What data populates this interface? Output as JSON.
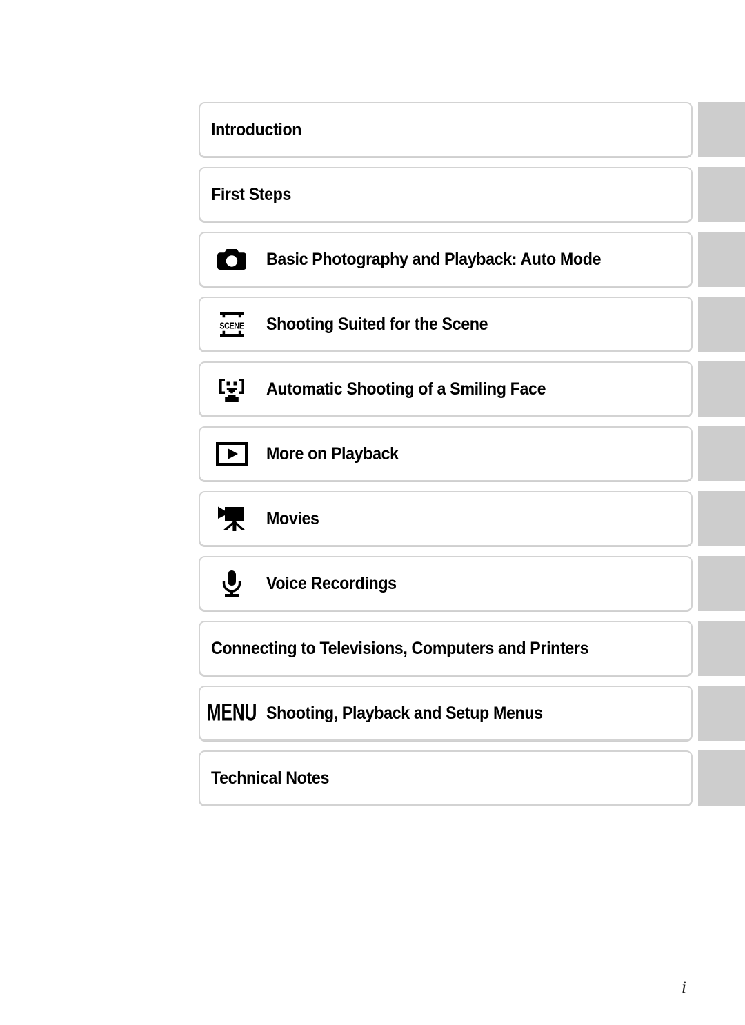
{
  "page": {
    "folio": "i"
  },
  "chapters": [
    {
      "label": "Introduction",
      "icon": "none"
    },
    {
      "label": "First Steps",
      "icon": "none"
    },
    {
      "label": "Basic Photography and Playback: Auto Mode",
      "icon": "camera-icon"
    },
    {
      "label": "Shooting Suited for the Scene",
      "icon": "scene-icon",
      "icon_text": "SCENE"
    },
    {
      "label": "Automatic Shooting of a Smiling Face",
      "icon": "smiling-face-icon"
    },
    {
      "label": "More on Playback",
      "icon": "playback-icon"
    },
    {
      "label": "Movies",
      "icon": "movie-camera-icon"
    },
    {
      "label": "Voice Recordings",
      "icon": "microphone-icon"
    },
    {
      "label": "Connecting to Televisions, Computers and Printers",
      "icon": "none"
    },
    {
      "label": "Shooting, Playback and Setup Menus",
      "icon": "menu-icon",
      "icon_text": "MENU"
    },
    {
      "label": "Technical Notes",
      "icon": "none"
    }
  ],
  "colors": {
    "tab_gray": "#cdcdcd",
    "box_border": "#d3d3d3",
    "text": "#000000",
    "background": "#ffffff"
  }
}
